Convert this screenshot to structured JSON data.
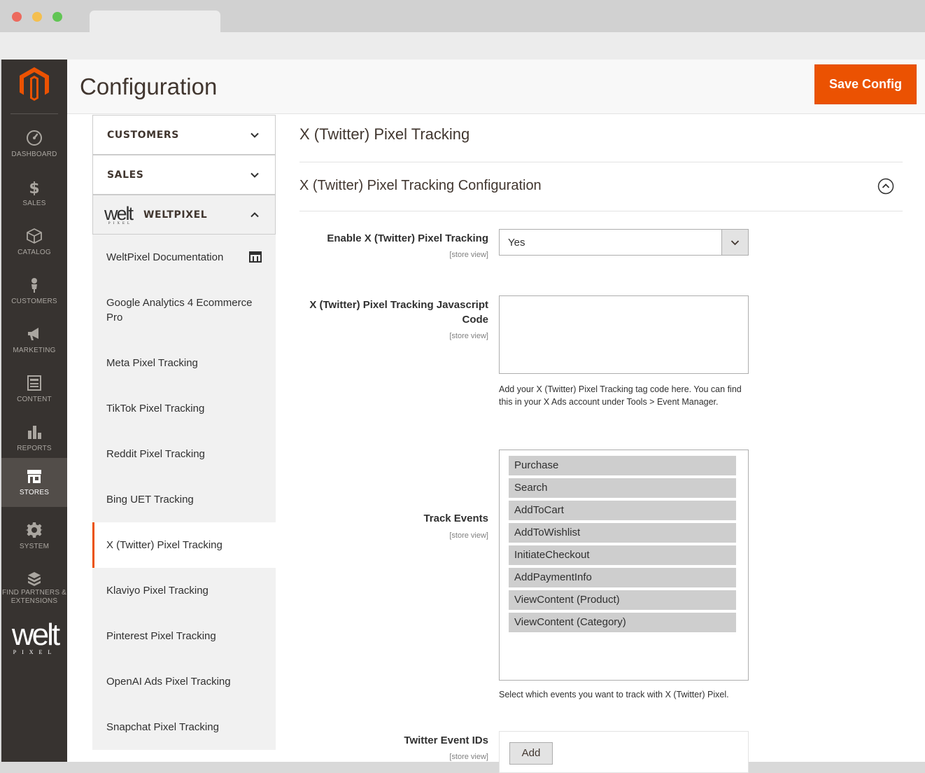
{
  "header": {
    "title": "Configuration",
    "save_label": "Save Config"
  },
  "admin_nav": {
    "items": [
      {
        "label": "DASHBOARD",
        "icon": "dashboard-icon"
      },
      {
        "label": "SALES",
        "icon": "dollar-icon"
      },
      {
        "label": "CATALOG",
        "icon": "cube-icon"
      },
      {
        "label": "CUSTOMERS",
        "icon": "person-icon"
      },
      {
        "label": "MARKETING",
        "icon": "megaphone-icon"
      },
      {
        "label": "CONTENT",
        "icon": "content-icon"
      },
      {
        "label": "REPORTS",
        "icon": "bar-chart-icon"
      },
      {
        "label": "STORES",
        "icon": "store-icon"
      },
      {
        "label": "SYSTEM",
        "icon": "gear-icon"
      },
      {
        "label": "FIND PARTNERS & EXTENSIONS",
        "icon": "extensions-icon"
      }
    ],
    "active": "STORES",
    "brand_logo": {
      "big": "welt",
      "small": "PIXEL"
    }
  },
  "config_nav": {
    "tabs": [
      {
        "label": "CUSTOMERS",
        "expanded": false
      },
      {
        "label": "SALES",
        "expanded": false
      },
      {
        "label": "WELTPIXEL",
        "expanded": true
      }
    ],
    "weltpixel_logo": {
      "big": "welt",
      "small": "PIXEL"
    },
    "items": [
      {
        "label": "WeltPixel Documentation"
      },
      {
        "label": "Google Analytics 4 Ecommerce Pro"
      },
      {
        "label": "Meta Pixel Tracking"
      },
      {
        "label": "TikTok Pixel Tracking"
      },
      {
        "label": "Reddit Pixel Tracking"
      },
      {
        "label": "Bing UET Tracking"
      },
      {
        "label": "X (Twitter) Pixel Tracking"
      },
      {
        "label": "Klaviyo Pixel Tracking"
      },
      {
        "label": "Pinterest Pixel Tracking"
      },
      {
        "label": "OpenAI Ads Pixel Tracking"
      },
      {
        "label": "Snapchat Pixel Tracking"
      }
    ],
    "active_item": "X (Twitter) Pixel Tracking"
  },
  "main": {
    "section_title": "X (Twitter) Pixel Tracking",
    "group_title": "X (Twitter) Pixel Tracking Configuration",
    "fields": {
      "enable": {
        "label": "Enable X (Twitter) Pixel Tracking",
        "scope": "[store view]",
        "value": "Yes"
      },
      "js_code": {
        "label": "X (Twitter) Pixel Tracking Javascript Code",
        "scope": "[store view]",
        "value": "",
        "note": "Add your X (Twitter) Pixel Tracking tag code here. You can find this in your X Ads account under Tools > Event Manager."
      },
      "track_events": {
        "label": "Track Events",
        "scope": "[store view]",
        "options": [
          "Purchase",
          "Search",
          "AddToCart",
          "AddToWishlist",
          "InitiateCheckout",
          "AddPaymentInfo",
          "ViewContent (Product)",
          "ViewContent (Category)"
        ],
        "note": "Select which events you want to track with X (Twitter) Pixel."
      },
      "event_ids": {
        "label": "Twitter Event IDs",
        "scope": "[store view]",
        "add_label": "Add"
      }
    }
  },
  "colors": {
    "accent": "#eb5202",
    "nav_bg": "#373330",
    "nav_active": "#524d49"
  }
}
